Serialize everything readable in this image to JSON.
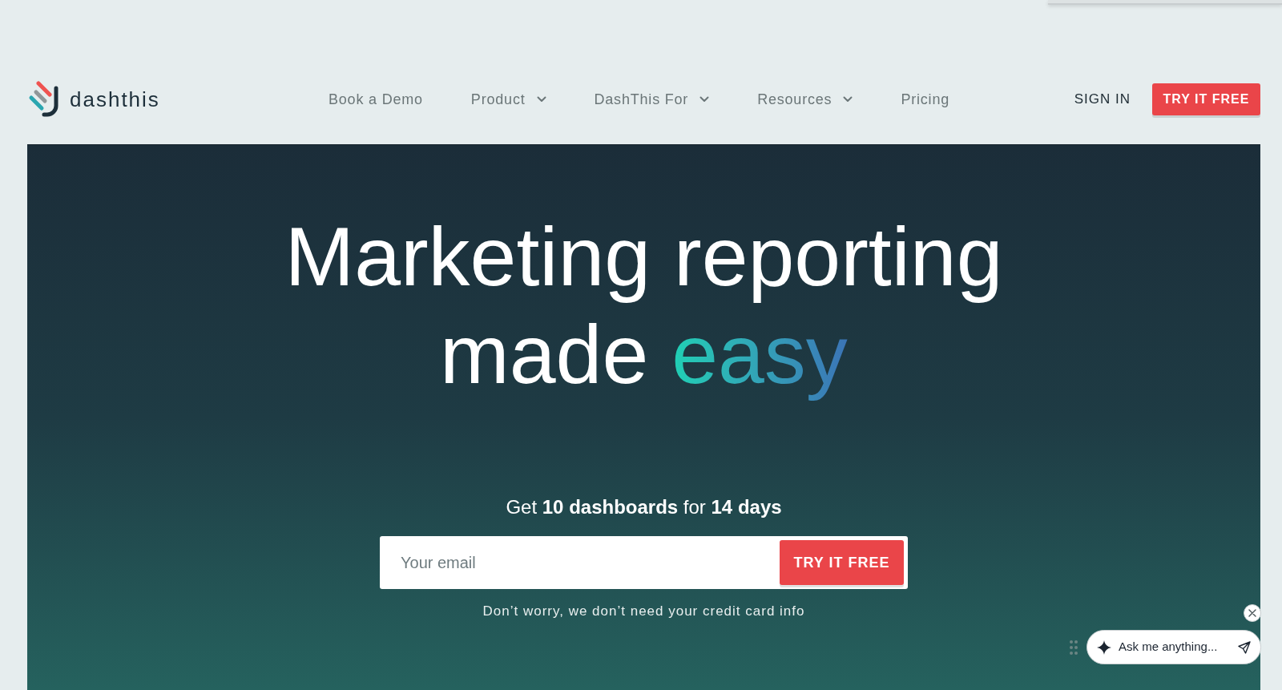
{
  "logo": {
    "text": "dashthis"
  },
  "nav": {
    "items": [
      {
        "label": "Book a Demo",
        "kind": "link"
      },
      {
        "label": "Product",
        "kind": "dropdown"
      },
      {
        "label": "DashThis For",
        "kind": "dropdown"
      },
      {
        "label": "Resources",
        "kind": "dropdown"
      },
      {
        "label": "Pricing",
        "kind": "link"
      }
    ],
    "sign_in": "SIGN IN",
    "cta_button": "TRY IT FREE"
  },
  "hero": {
    "headline": {
      "lines": [
        "Marketing reporting",
        "made"
      ],
      "highlight": "easy"
    },
    "offer": "Get **10 dashboards** for **14 days**",
    "email_field": {
      "placeholder": "Your email"
    },
    "submit_button": "TRY IT FREE",
    "note": "Don’t worry, we don’t need your credit card info"
  },
  "chat_widget": {
    "placeholder": "Ask me anything..."
  }
}
